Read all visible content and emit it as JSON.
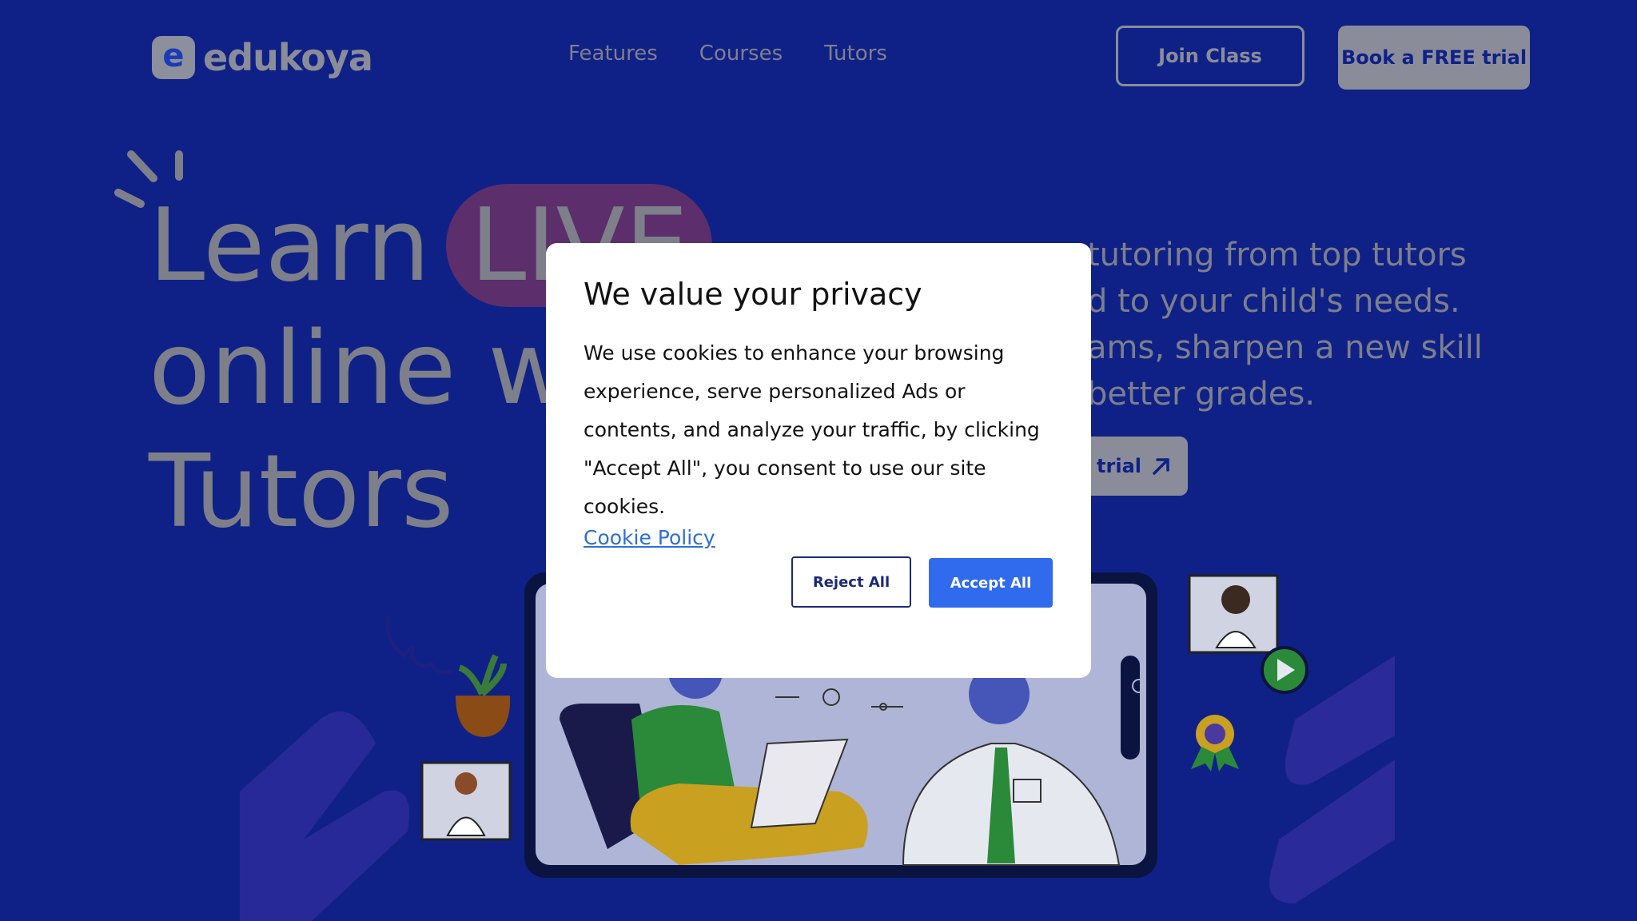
{
  "nav": {
    "logo_letter": "e",
    "logo_text": "edukoya",
    "links": [
      "Features",
      "Courses",
      "Tutors"
    ],
    "join_label": "Join Class",
    "trial_label": "Book a FREE trial"
  },
  "hero": {
    "title_line1_a": "Learn",
    "title_live": "LIVE",
    "title_line2": "online w",
    "title_line3": "Tutors",
    "subtitle_lines": [
      "tutoring from top tutors",
      "d to your child's needs.",
      "ams, sharpen a new skill",
      "better grades."
    ],
    "cta_label": "trial",
    "cta_icon": "arrow-up-right-icon"
  },
  "modal": {
    "title": "We value your privacy",
    "body": "We use cookies to enhance your browsing experience, serve personalized Ads or contents, and analyze your traffic, by clicking \"Accept All\", you consent to use our site cookies.",
    "link_label": "Cookie Policy",
    "reject_label": "Reject All",
    "accept_label": "Accept All"
  },
  "colors": {
    "page_bg": "#0f2187",
    "accent": "#2f6bec",
    "live_pill": "#5c2e6b"
  }
}
